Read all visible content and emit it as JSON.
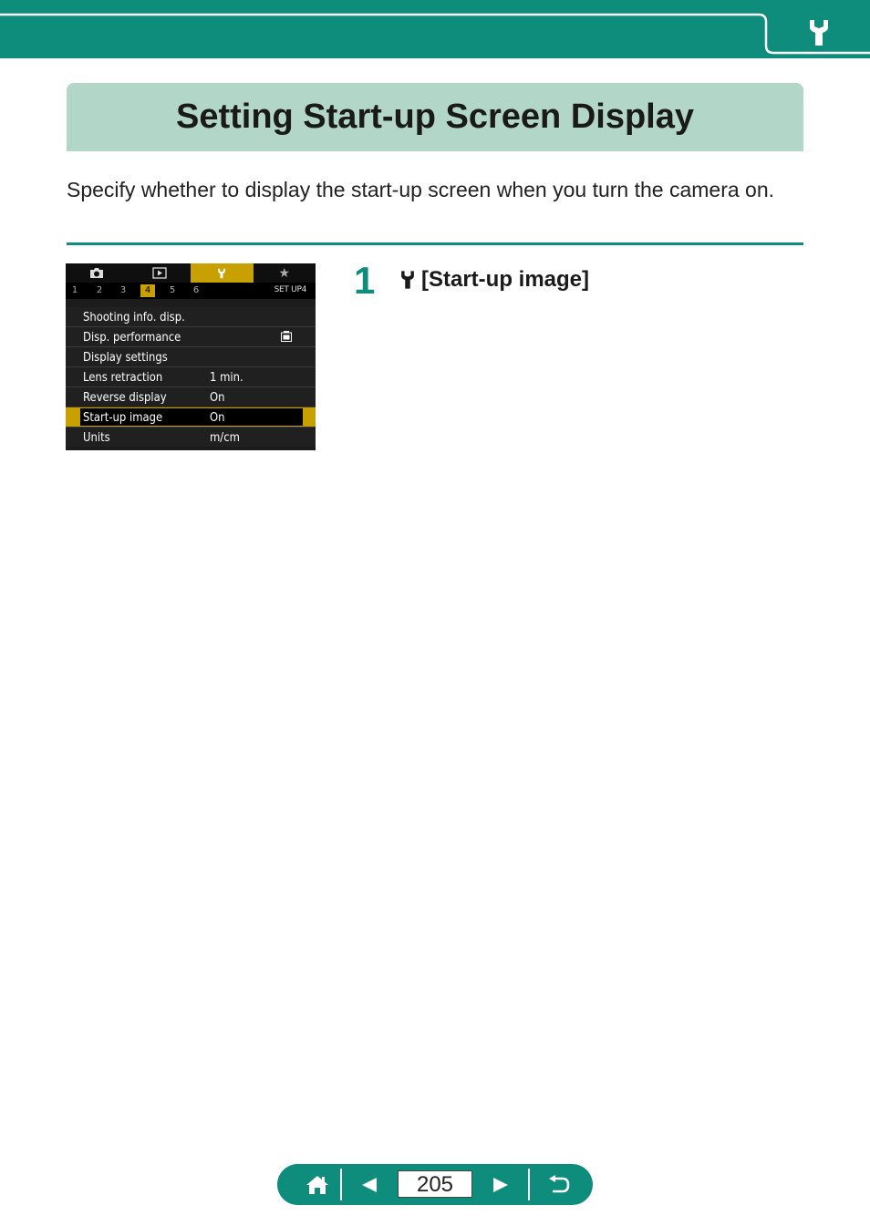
{
  "header": {
    "section_icon": "wrench-icon",
    "accent_color": "#0e8c7c"
  },
  "title": "Setting Start-up Screen Display",
  "intro": "Specify whether to display the start-up screen when you turn the camera on.",
  "camera_menu": {
    "tabs": [
      "camera-icon",
      "playback-icon",
      "wrench-icon",
      "star-icon"
    ],
    "subtabs": [
      "1",
      "2",
      "3",
      "4",
      "5",
      "6"
    ],
    "active_subtab": "4",
    "setup_label": "SET UP4",
    "rows": [
      {
        "label": "Shooting info. disp.",
        "value": ""
      },
      {
        "label": "Disp. performance",
        "value": "",
        "icon": "fps-icon"
      },
      {
        "label": "Display settings",
        "value": ""
      },
      {
        "label": "Lens retraction",
        "value": "1 min."
      },
      {
        "label": "Reverse display",
        "value": "On"
      },
      {
        "label": "Start-up image",
        "value": "On",
        "selected": true
      },
      {
        "label": "Units",
        "value": "m/cm"
      }
    ]
  },
  "step": {
    "number": "1",
    "text": "[Start-up image]",
    "icon": "wrench-icon"
  },
  "nav": {
    "page": "205",
    "buttons": [
      "home-icon",
      "prev-icon",
      "next-icon",
      "back-icon"
    ]
  }
}
